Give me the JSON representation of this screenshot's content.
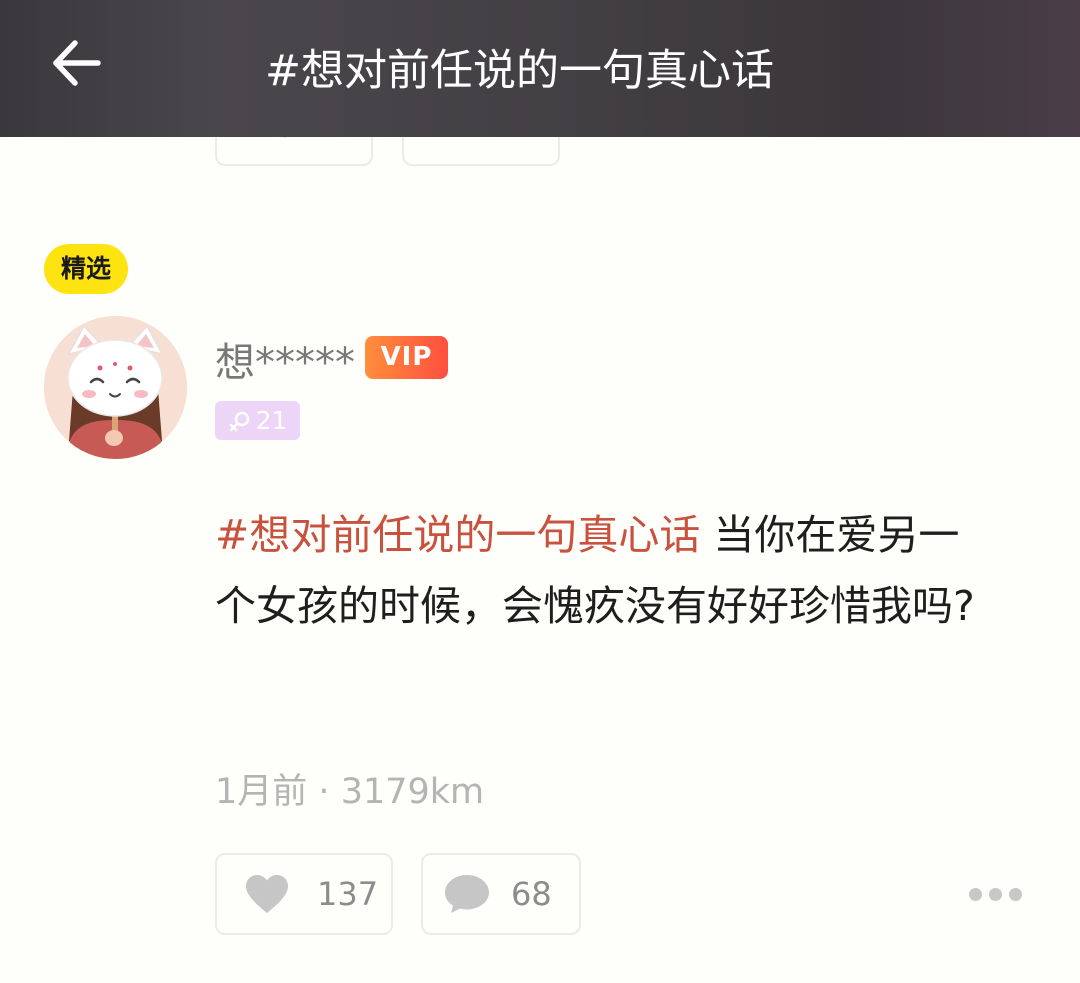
{
  "header": {
    "title": "#想对前任说的一句真心话"
  },
  "post": {
    "featured_badge": "精选",
    "username": "想*****",
    "vip_label": "VIP",
    "level_value": "21",
    "topic": "#想对前任说的一句真心话",
    "body": " 当你在爱另一个女孩的时候，会愧疚没有好好珍惜我吗?",
    "time": "1月前",
    "separator": "·",
    "distance": "3179km",
    "like_count": "137",
    "comment_count": "68"
  },
  "colors": {
    "topic": "#c9523f",
    "featured_bg": "#fde410",
    "vip_gradient_start": "#ff8e3c",
    "vip_gradient_end": "#ff4f3f",
    "level_bg": "#ecd5f7"
  },
  "icons": {
    "back": "arrow-left-icon",
    "like": "heart-icon",
    "comment": "chat-bubble-icon",
    "more": "more-dots-icon",
    "level": "female-symbol-icon"
  }
}
